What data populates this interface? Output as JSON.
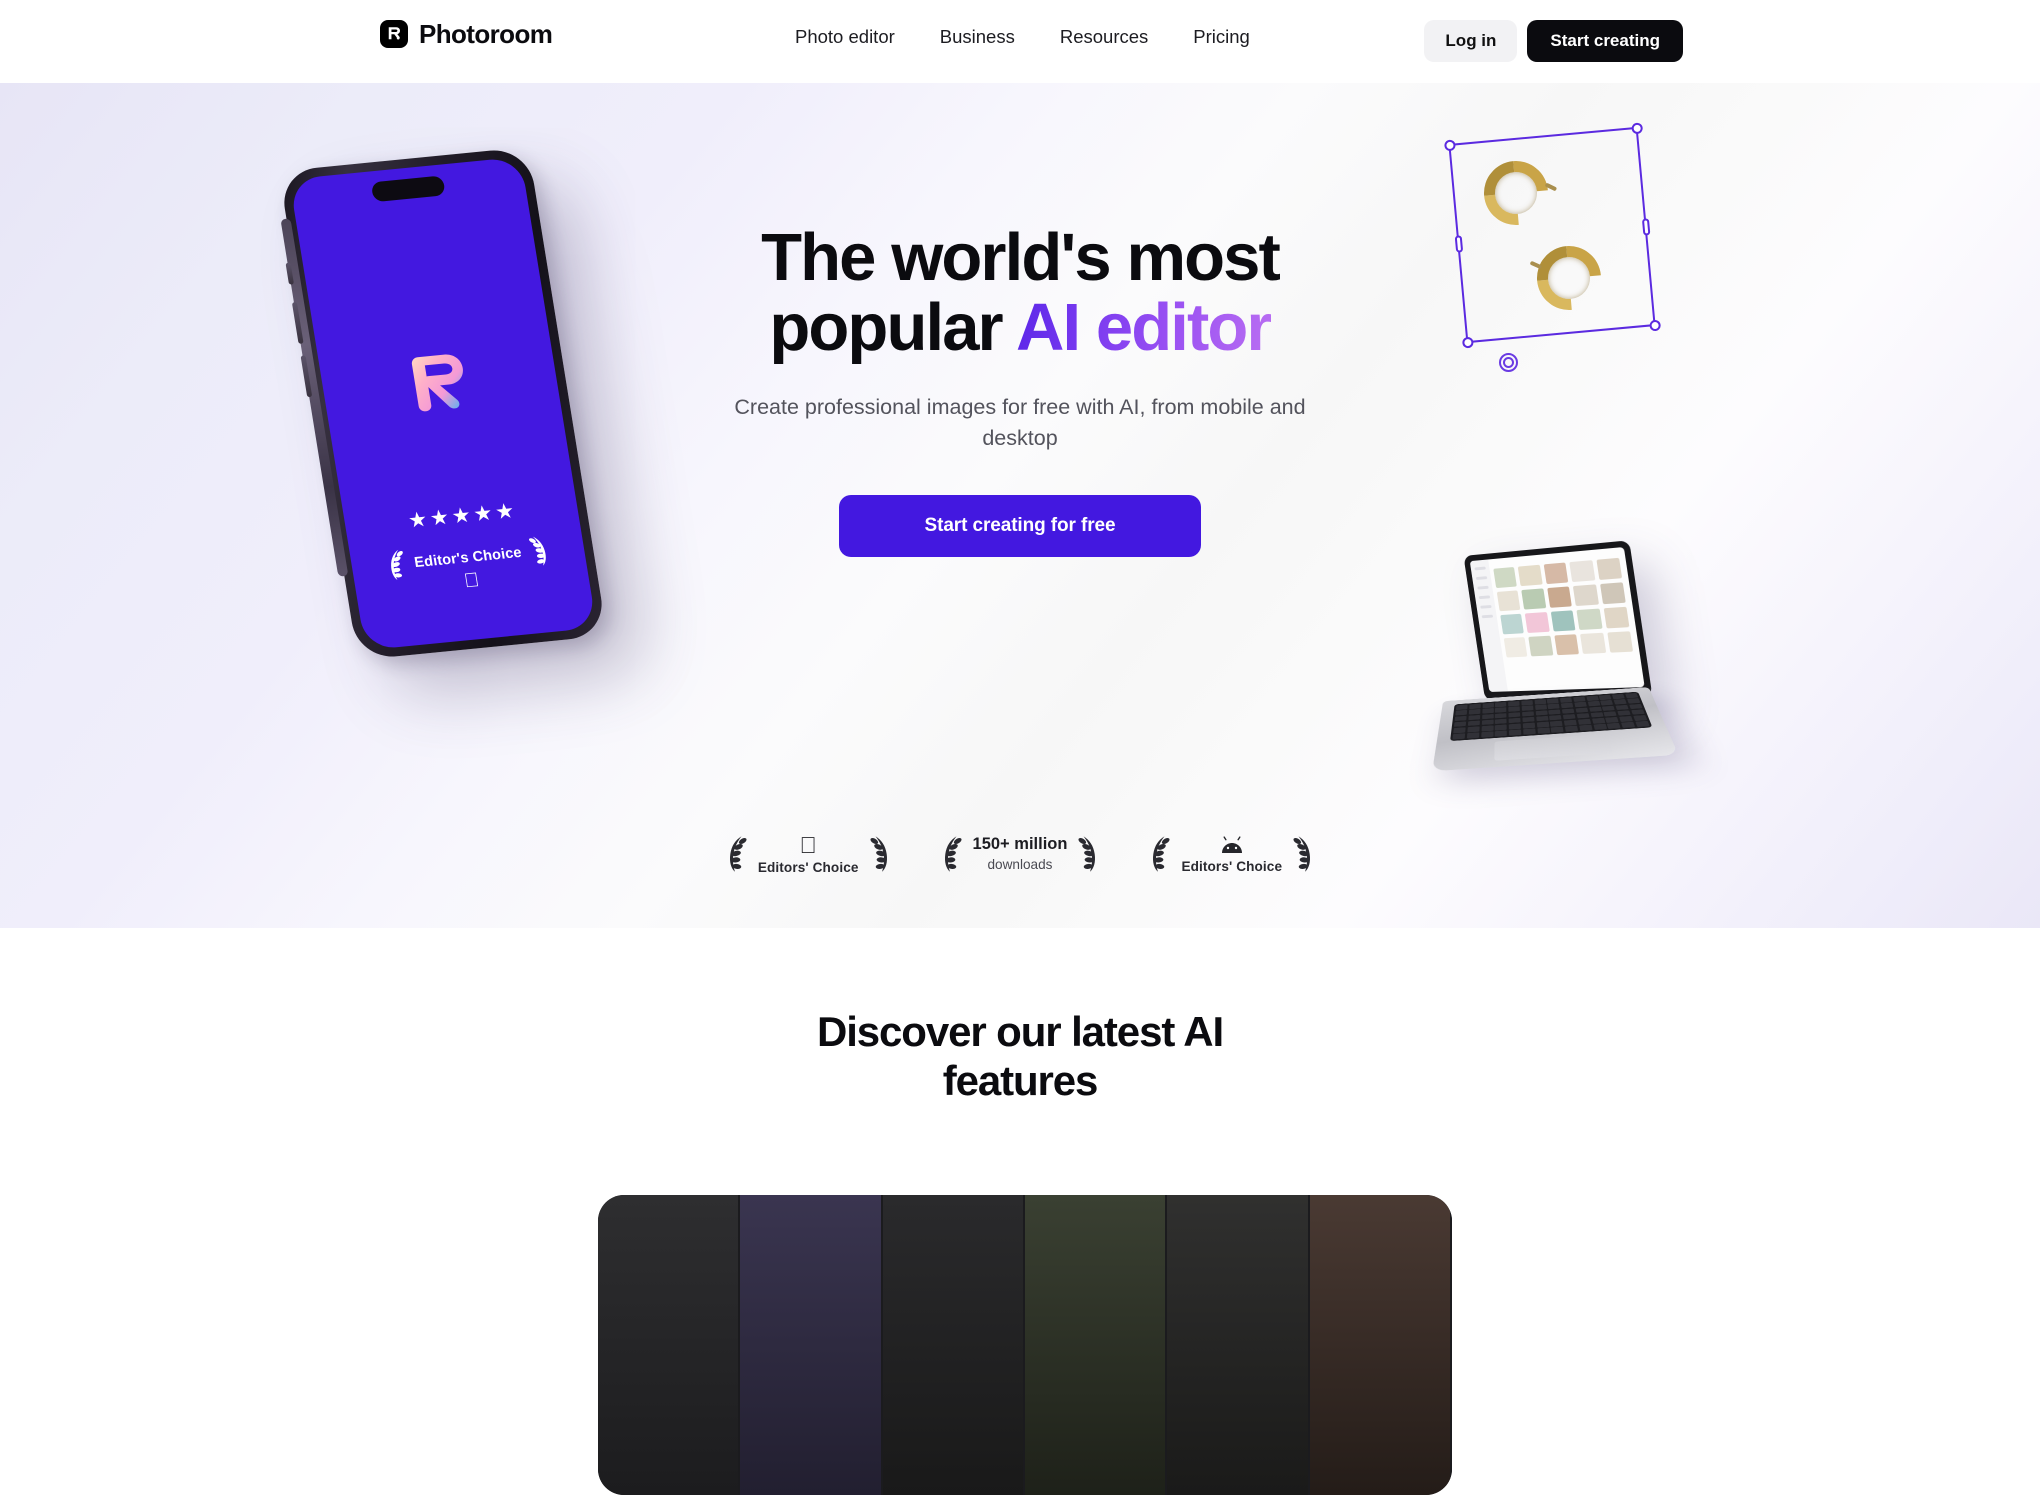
{
  "brand": {
    "name": "Photoroom",
    "logo_icon": "photoroom-r-logo-icon",
    "accent_purple": "#4318e0",
    "gradient_start": "#5b27e8",
    "gradient_end": "#b96ef2"
  },
  "header": {
    "nav": [
      {
        "label": "Photo editor"
      },
      {
        "label": "Business"
      },
      {
        "label": "Resources"
      },
      {
        "label": "Pricing"
      }
    ],
    "login_label": "Log in",
    "start_label": "Start creating"
  },
  "hero": {
    "headline_line1": "The world's most",
    "headline_line2_plain": "popular ",
    "headline_line2_accent": "AI editor",
    "subtitle": "Create professional images for free with AI, from mobile and desktop",
    "cta_label": "Start creating for free",
    "phone": {
      "screen_color": "#4318e0",
      "stars": "★★★★★",
      "award_label": "Editor's Choice",
      "store_icon": "apple-icon",
      "app_logo_icon": "photoroom-r-gradient-icon"
    },
    "canvas": {
      "subject": "gold hoop earrings",
      "selection_color": "#5b2ae0",
      "rotate_handle_icon": "rotate-handle-icon"
    },
    "awards": [
      {
        "icon": "apple-icon",
        "label": "Editors' Choice",
        "wreath": "laurel-wreath-icon"
      },
      {
        "big": "150+ million",
        "small": "downloads",
        "wreath": "laurel-wreath-icon"
      },
      {
        "icon": "android-icon",
        "label": "Editors' Choice",
        "wreath": "laurel-wreath-icon"
      }
    ]
  },
  "features": {
    "title_line1": "Discover our latest AI",
    "title_line2": "features",
    "panel_background": "#121214"
  }
}
